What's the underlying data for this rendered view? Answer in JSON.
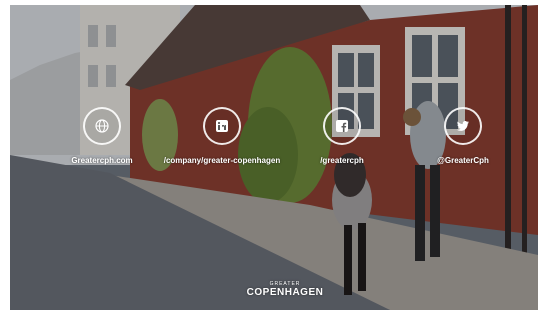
{
  "social": [
    {
      "icon": "globe-icon",
      "label": "Greatercph.com"
    },
    {
      "icon": "linkedin-icon",
      "label": "/company/greater-copenhagen"
    },
    {
      "icon": "facebook-icon",
      "label": "/greatercph"
    },
    {
      "icon": "twitter-icon",
      "label": "@GreaterCph"
    }
  ],
  "logo": {
    "top_text": "GREATER",
    "main_text": "COPENHAGEN"
  },
  "colors": {
    "overlay_text": "#ffffff",
    "wall": "#8c3f33",
    "roof": "#5b4a45",
    "cobblestone": "#6b7079",
    "foliage": "#6f8a3c"
  }
}
